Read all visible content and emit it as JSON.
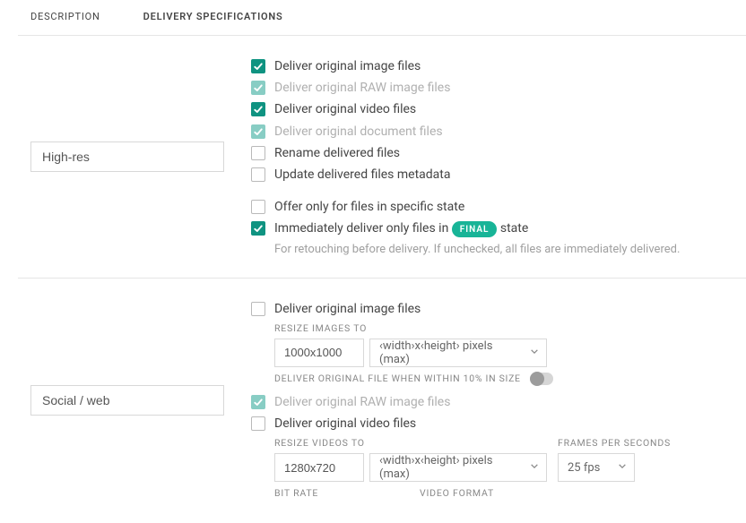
{
  "tabs": {
    "description": "DESCRIPTION",
    "delivery": "DELIVERY SPECIFICATIONS"
  },
  "rows": [
    {
      "name": "High-res",
      "opts": {
        "deliver_img": "Deliver original image files",
        "deliver_raw": "Deliver original RAW image files",
        "deliver_video": "Deliver original video files",
        "deliver_doc": "Deliver original document files",
        "rename": "Rename delivered files",
        "update_meta": "Update delivered files metadata",
        "offer_state": "Offer only for files in specific state",
        "immediate_a": "Immediately deliver only files in ",
        "final_badge": "FINAL",
        "immediate_b": " state",
        "immediate_help": "For retouching before delivery. If unchecked, all files are immediately delivered."
      }
    },
    {
      "name": "Social / web",
      "opts": {
        "deliver_img": "Deliver original image files",
        "resize_images_to": "RESIZE IMAGES TO",
        "img_size": "1000x1000",
        "img_unit": "‹width›x‹height› pixels (max)",
        "orig_within": "DELIVER ORIGINAL FILE WHEN WITHIN 10% IN SIZE",
        "deliver_raw": "Deliver original RAW image files",
        "deliver_video": "Deliver original video files",
        "resize_videos_to": "RESIZE VIDEOS TO",
        "vid_size": "1280x720",
        "vid_unit": "‹width›x‹height› pixels (max)",
        "fps_label": "FRAMES PER SECONDS",
        "fps": "25 fps",
        "bitrate_label": "BIT RATE",
        "vformat_label": "VIDEO FORMAT"
      }
    }
  ]
}
